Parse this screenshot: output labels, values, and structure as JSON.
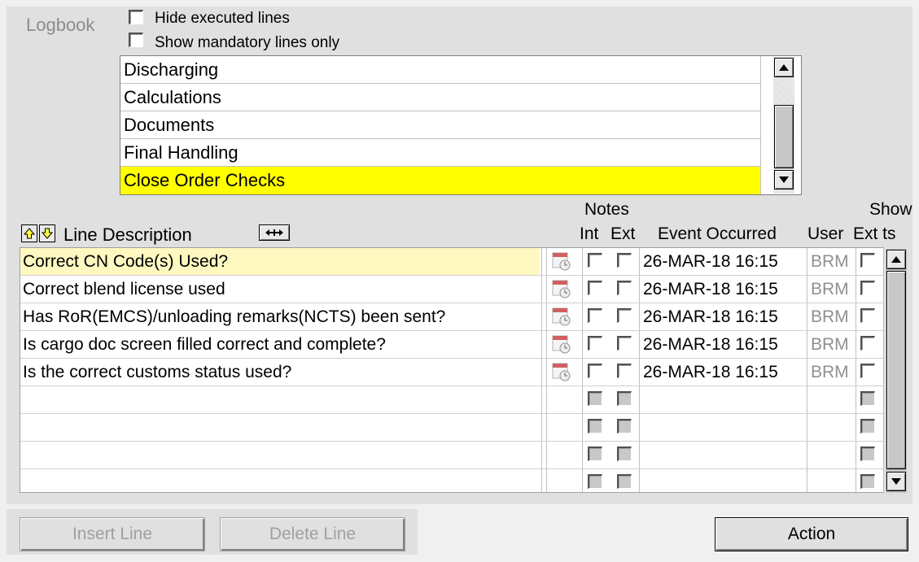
{
  "logbook": {
    "label": "Logbook"
  },
  "options": {
    "hide_executed": "Hide executed lines",
    "mandatory_only": "Show mandatory lines only"
  },
  "sections": [
    "Discharging",
    "Calculations",
    "Documents",
    "Final Handling",
    "Close Order Checks"
  ],
  "selected_section": "Close Order Checks",
  "grid": {
    "headers": {
      "line_description": "Line Description",
      "notes": "Notes",
      "int": "Int",
      "ext": "Ext",
      "event_occurred": "Event Occurred",
      "user": "User",
      "show": "Show",
      "ext_ts": "Ext ts"
    },
    "rows": [
      {
        "description": "Correct CN Code(s) Used?",
        "event": "26-MAR-18 16:15",
        "user": "BRM"
      },
      {
        "description": "Correct blend license used",
        "event": "26-MAR-18 16:15",
        "user": "BRM"
      },
      {
        "description": "Has RoR(EMCS)/unloading remarks(NCTS) been sent?",
        "event": "26-MAR-18 16:15",
        "user": "BRM"
      },
      {
        "description": "Is cargo doc screen filled correct and complete?",
        "event": "26-MAR-18 16:15",
        "user": "BRM"
      },
      {
        "description": "Is the correct customs status used?",
        "event": "26-MAR-18 16:15",
        "user": "BRM"
      }
    ],
    "empty_rows": 4
  },
  "buttons": {
    "insert_line": "Insert Line",
    "delete_line": "Delete Line",
    "action": "Action"
  },
  "colors": {
    "selected": "#ffff00",
    "selected_row": "#fff8c0",
    "panel": "#e0e0e0"
  },
  "icons": [
    "up-arrow-icon",
    "down-arrow-icon",
    "expand-columns-icon",
    "calendar-clock-icon",
    "scroll-up-icon",
    "scroll-down-icon"
  ]
}
